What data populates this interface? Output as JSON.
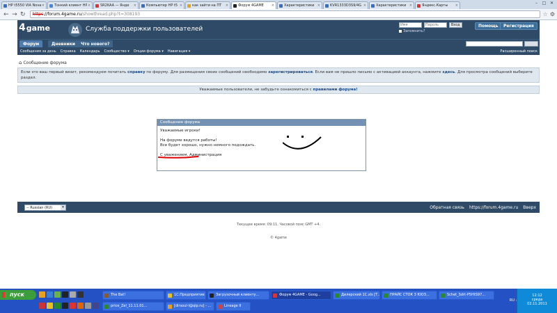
{
  "browser": {
    "tabs": [
      {
        "label": "HP t5550 VIA Nova",
        "color": "#3a6fbf",
        "active": false
      },
      {
        "label": "Тонкий клиент HP",
        "color": "#4a86d6",
        "active": false
      },
      {
        "label": "SR2KAA — Янде",
        "color": "#d33",
        "active": false
      },
      {
        "label": "Компьютер HP t5",
        "color": "#3a6fbf",
        "active": false
      },
      {
        "label": "как зайти на ПТ",
        "color": "#e8a020",
        "active": false
      },
      {
        "label": "Форум 4GAME",
        "color": "#222",
        "active": true
      },
      {
        "label": "Характеристики",
        "color": "#3a6fbf",
        "active": false
      },
      {
        "label": "KVR1333D3S9/4G",
        "color": "#3a6fbf",
        "active": false
      },
      {
        "label": "Характеристики",
        "color": "#3a6fbf",
        "active": false
      },
      {
        "label": "Яндекс.Карты",
        "color": "#d33",
        "active": false
      }
    ],
    "url": {
      "scheme": "https",
      "host": "://forum.4game.ru",
      "path": "/showthread.php?t=308193"
    }
  },
  "site": {
    "logo": "game",
    "title": "Служба поддержки пользователей",
    "login": {
      "user_placeholder": "Имя",
      "pass_placeholder": "Пароль",
      "go_label": "Вход",
      "remember_label": "Запомнить?"
    },
    "help_button": "Помощь",
    "register_button": "Регистрация",
    "nav_tabs": [
      "Форум",
      "Дневники",
      "Что нового?"
    ],
    "subnav": [
      "Сообщения за день",
      "Справка",
      "Календарь",
      "Сообщество ▾",
      "Опции форума ▾",
      "Навигация ▾"
    ],
    "advanced_search": "Расширенный поиск",
    "breadcrumb": "Сообщение форума",
    "notice": {
      "part1": "Если это ваш первый визит, рекомендуем почитать ",
      "link1": "справку",
      "part2": " по форуму. Для размещения своих сообщений необходимо ",
      "link2": "зарегистрироваться",
      "part3": ". Если вам не пришло письмо с активацией аккаунта, нажмите ",
      "link3": "здесь",
      "part4": ". Для просмотра сообщений выберите раздел."
    },
    "announce": {
      "text": "Уважаемые пользователи, не забудьте ознакомиться с ",
      "link": "правилами форума!"
    },
    "message": {
      "header": "Сообщение форума",
      "line1": "Уважаемые игроки!",
      "line2": "На форуме ведутся работы!",
      "line3": "Все будет хорошо, нужно немного подождать.",
      "line4": "С уважением, Администрация"
    },
    "footer": {
      "language": "-- Russian (RU)",
      "links": [
        "Обратная связь",
        "https://forum.4game.ru",
        "Вверх"
      ],
      "time": "Текущее время: 09:11. Часовой пояс GMT +4.",
      "copyright": "© 4game"
    }
  },
  "taskbar": {
    "start": "пуск",
    "row1": [
      {
        "label": "The Bat!",
        "color": "#8a5a2a"
      },
      {
        "label": "1С:Предприятие - К...",
        "color": "#e8c020"
      },
      {
        "label": "Загрузочный клиенту...",
        "color": "#222"
      },
      {
        "label": "Форум 4GAME - Goog...",
        "color": "#d33",
        "active": true
      },
      {
        "label": "Дилерский 1С.xls [Т...",
        "color": "#2a8a2a"
      },
      {
        "label": "ПРАЙС СТОК 3 ЮОЗ...",
        "color": "#2a8a2a"
      },
      {
        "label": "Schet_Sdrt-P5HtS97...",
        "color": "#2a8a2a"
      }
    ],
    "row2": [
      {
        "label": "price_Zel_11.11.01...",
        "color": "#2a8a2a"
      },
      {
        "label": "[dirsoul-l@qip.ru] - ...",
        "color": "#e8a020"
      },
      {
        "label": "Lineage II",
        "color": "#c44"
      }
    ],
    "lang": "RU",
    "time": "12:12",
    "day": "среда",
    "date": "02.11.2011"
  }
}
